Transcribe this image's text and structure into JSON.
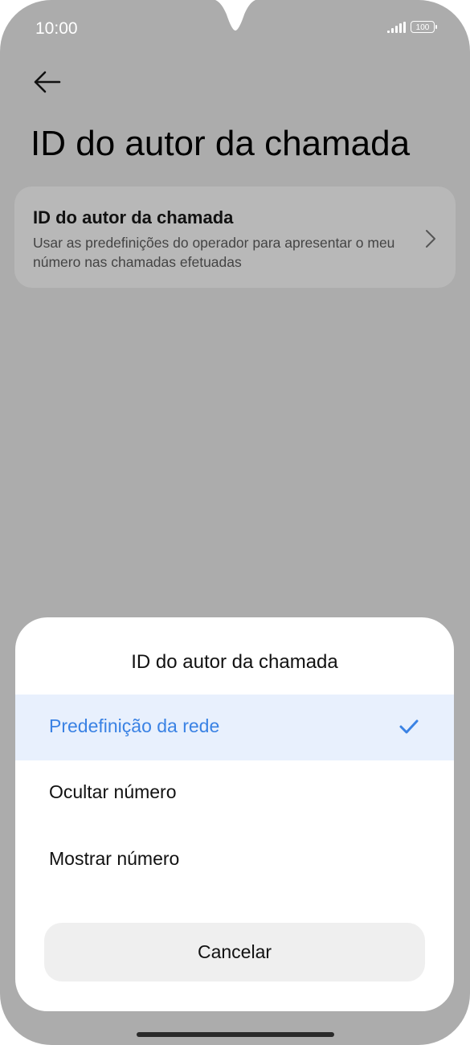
{
  "status_bar": {
    "time": "10:00",
    "battery": "100"
  },
  "header": {
    "back_icon": "arrow-left-icon",
    "title": "ID do autor da chamada"
  },
  "setting": {
    "title": "ID do autor da chamada",
    "description": "Usar as predefinições do operador para apresentar o meu número nas chamadas efetuadas",
    "chevron_icon": "chevron-right-icon"
  },
  "dialog": {
    "title": "ID do autor da chamada",
    "options": [
      {
        "label": "Predefinição da rede",
        "selected": true
      },
      {
        "label": "Ocultar número",
        "selected": false
      },
      {
        "label": "Mostrar número",
        "selected": false
      }
    ],
    "check_icon": "checkmark-icon",
    "cancel_label": "Cancelar"
  },
  "colors": {
    "scrim": "#acacac",
    "accent": "#3a82e4",
    "selected_bg": "#e8f0fd"
  }
}
